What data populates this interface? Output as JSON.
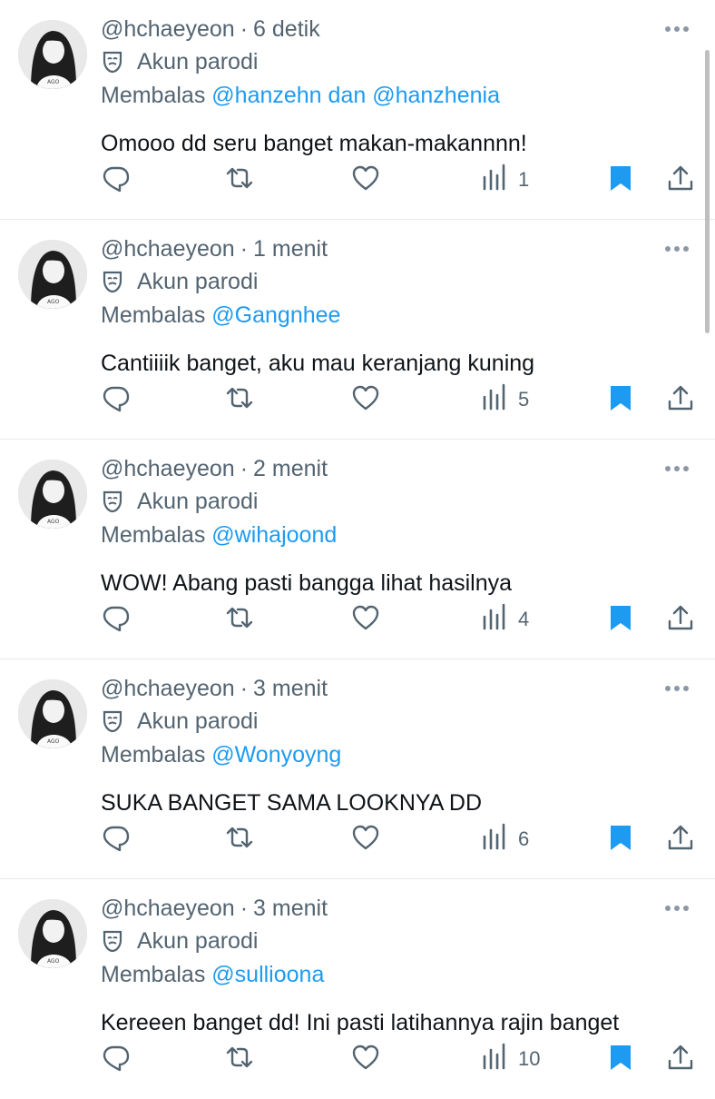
{
  "parody_label": "Akun parodi",
  "reply_prefix": "Membalas",
  "tweets": [
    {
      "handle": "@hchaeyeon",
      "sep": "·",
      "time": "6 detik",
      "mentions": [
        "@hanzehn",
        "dan",
        "@hanzhenia"
      ],
      "text": "Omooo dd seru banget makan-makannnn!",
      "views": "1"
    },
    {
      "handle": "@hchaeyeon",
      "sep": "·",
      "time": "1 menit",
      "mentions": [
        "@Gangnhee"
      ],
      "text": "Cantiiiik banget, aku mau keranjang kuning",
      "views": "5"
    },
    {
      "handle": "@hchaeyeon",
      "sep": "·",
      "time": "2 menit",
      "mentions": [
        "@wihajoond"
      ],
      "text": "WOW! Abang pasti bangga lihat hasilnya",
      "views": "4"
    },
    {
      "handle": "@hchaeyeon",
      "sep": "·",
      "time": "3 menit",
      "mentions": [
        "@Wonyoyng"
      ],
      "text": "SUKA BANGET SAMA LOOKNYA DD",
      "views": "6"
    },
    {
      "handle": "@hchaeyeon",
      "sep": "·",
      "time": "3 menit",
      "mentions": [
        "@sullioona"
      ],
      "text": "Kereeen banget dd! Ini pasti latihannya rajin banget",
      "views": "10"
    }
  ],
  "icons": {
    "reply": "reply-icon",
    "retweet": "retweet-icon",
    "like": "like-icon",
    "views": "views-icon",
    "bookmark": "bookmark-icon",
    "share": "share-icon",
    "more": "more-icon",
    "parody": "parody-mask-icon"
  },
  "colors": {
    "accent": "#1d9bf0",
    "muted": "#536471",
    "text": "#0f1419",
    "divider": "#e6e9ec"
  }
}
